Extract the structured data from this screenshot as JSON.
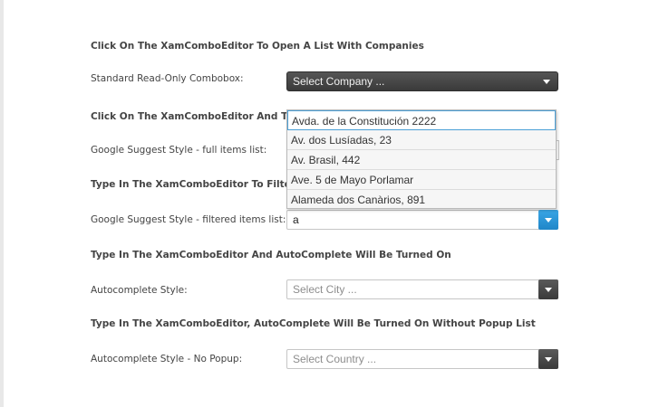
{
  "sections": [
    {
      "heading": "Click On The XamComboEditor To Open A List With Companies",
      "label": "Standard Read-Only Combobox:",
      "combo": {
        "placeholder": "Select Company ...",
        "style": "dark"
      }
    },
    {
      "heading": "Click On The XamComboEditor And Type T",
      "label": "Google Suggest Style - full items list:",
      "combo": {
        "placeholder": "",
        "style": "light"
      }
    },
    {
      "heading": "Type In The XamComboEditor To Filter A",
      "label": "Google Suggest Style - filtered items list:",
      "combo": {
        "value": "a",
        "style": "light-blue-button"
      }
    },
    {
      "heading": "Type In The XamComboEditor And AutoComplete Will Be Turned On",
      "label": "Autocomplete Style:",
      "combo": {
        "placeholder": "Select City ...",
        "style": "light"
      }
    },
    {
      "heading": "Type In The XamComboEditor, AutoComplete Will Be Turned On Without Popup List",
      "label": "Autocomplete Style - No Popup:",
      "combo": {
        "placeholder": "Select Country ...",
        "style": "light"
      }
    }
  ],
  "dropdown": {
    "items": [
      "Avda. de la Constitución 2222",
      "Av. dos Lusíadas, 23",
      "Av. Brasil, 442",
      "Ave. 5 de Mayo Porlamar",
      "Alameda dos Canàrios, 891"
    ],
    "selected_index": 0
  },
  "colors": {
    "accent_blue": "#1f86c8",
    "dark_button": "#3a3a3a"
  }
}
